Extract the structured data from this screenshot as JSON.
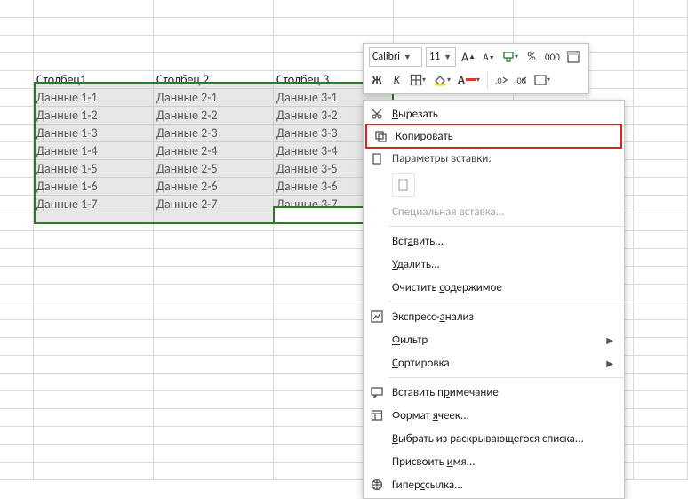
{
  "toolbar": {
    "font_name": "Calibri",
    "font_size": "11"
  },
  "table": {
    "headers": [
      "Столбец1",
      "Столбец 2",
      "Столбец 3"
    ],
    "rows": [
      [
        "Данные 1-1",
        "Данные 2-1",
        "Данные 3-1"
      ],
      [
        "Данные 1-2",
        "Данные 2-2",
        "Данные 3-2"
      ],
      [
        "Данные 1-3",
        "Данные 2-3",
        "Данные 3-3"
      ],
      [
        "Данные 1-4",
        "Данные 2-4",
        "Данные 3-4"
      ],
      [
        "Данные 1-5",
        "Данные 2-5",
        "Данные 3-5"
      ],
      [
        "Данные 1-6",
        "Данные 2-6",
        "Данные 3-6"
      ],
      [
        "Данные 1-7",
        "Данные 2-7",
        "Данные 3-7"
      ]
    ]
  },
  "menu": {
    "cut": "Вырезать",
    "copy": "Копировать",
    "paste_options": "Параметры вставки:",
    "paste_special": "Специальная вставка...",
    "insert": "Вставить...",
    "delete": "Удалить...",
    "clear": "Очистить содержимое",
    "quick_analysis": "Экспресс-анализ",
    "filter": "Фильтр",
    "sort": "Сортировка",
    "insert_comment": "Вставить примечание",
    "format_cells": "Формат ячеек...",
    "select_dropdown": "Выбрать из раскрывающегося списка...",
    "define_name": "Присвоить имя...",
    "hyperlink": "Гиперссылка..."
  }
}
